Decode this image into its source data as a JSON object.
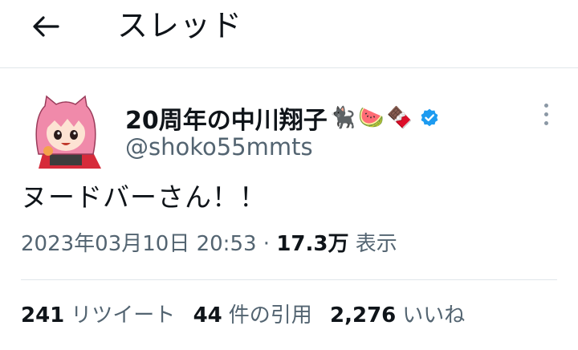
{
  "header": {
    "title": "スレッド",
    "back_icon": "arrow-left-icon"
  },
  "author": {
    "display_name": "20周年の中川翔子",
    "emojis": [
      "🐈‍⬛",
      "🍉",
      "🍫"
    ],
    "handle": "@shoko55mmts",
    "verified_color": "#1d9bf0"
  },
  "tweet": {
    "text": "ヌードバーさん！！",
    "timestamp": "2023年03月10日 20:53",
    "separator": "·",
    "views_count": "17.3万",
    "views_label": "表示"
  },
  "stats": {
    "retweets": {
      "count": "241",
      "label": "リツイート"
    },
    "quotes": {
      "count": "44",
      "label": "件の引用"
    },
    "likes": {
      "count": "2,276",
      "label": "いいね"
    }
  },
  "colors": {
    "text": "#0f1419",
    "secondary": "#536471",
    "divider": "#e1e6ea"
  }
}
